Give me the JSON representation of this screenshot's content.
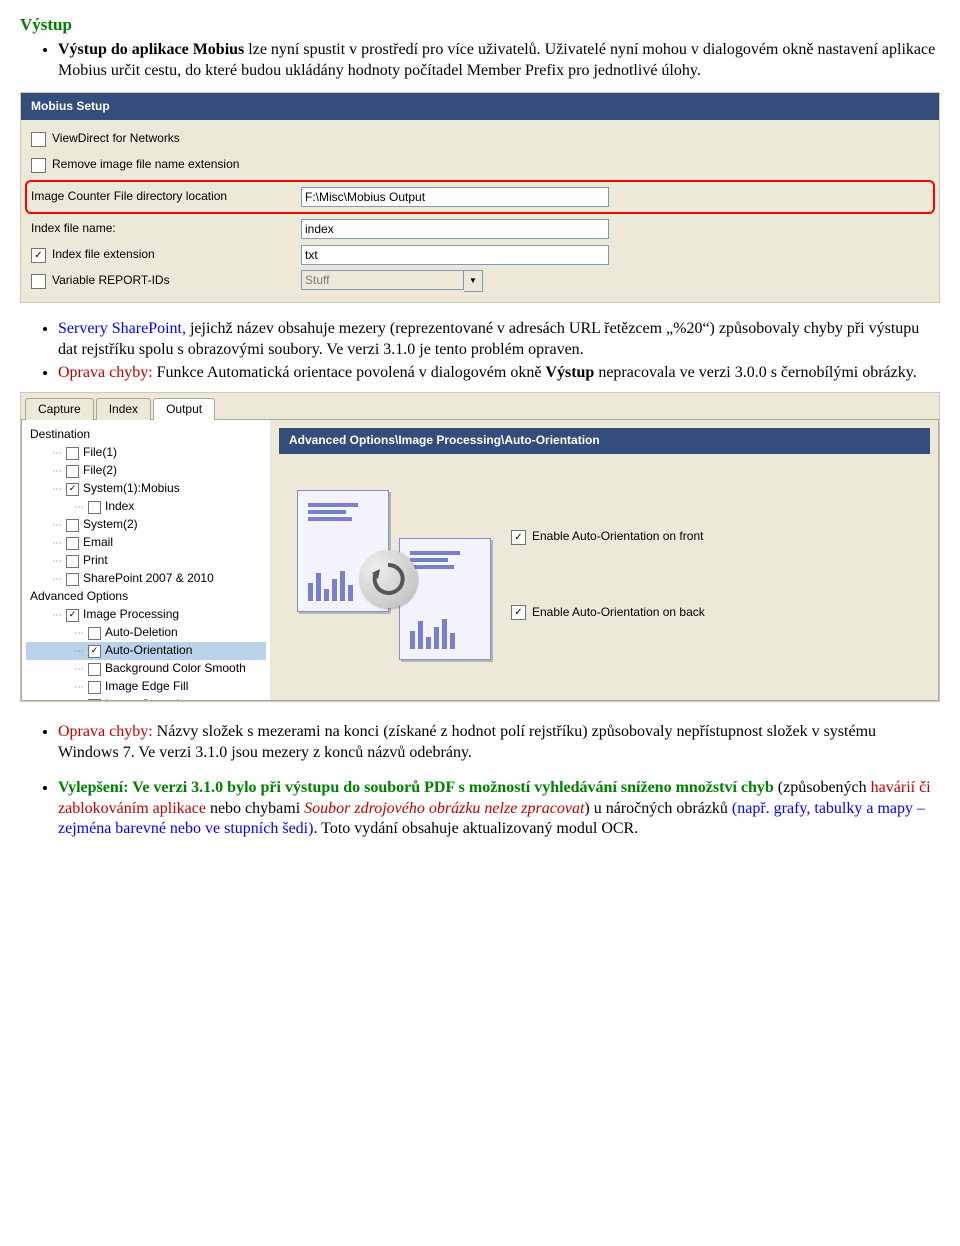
{
  "heading": "Výstup",
  "intro_bullet": {
    "before_bold": "",
    "bold": "Výstup do aplikace Mobius",
    "after": " lze nyní spustit v prostředí pro více uživatelů. Uživatelé nyní mohou v dialogovém okně nastavení aplikace Mobius určit cestu, do které budou ukládány hodnoty počítadel Member Prefix pro jednotlivé úlohy."
  },
  "mobius_panel": {
    "title": "Mobius Setup",
    "rows": [
      {
        "type": "checkbox",
        "label": "ViewDirect for Networks",
        "checked": false
      },
      {
        "type": "checkbox",
        "label": "Remove image file name extension",
        "checked": false
      },
      {
        "type": "labelinput",
        "label": "Image Counter File directory location",
        "value": "F:\\Misc\\Mobius Output",
        "highlight": true
      },
      {
        "type": "labelinput",
        "label": "Index file name:",
        "value": "index"
      },
      {
        "type": "checkinput",
        "label": "Index file extension",
        "checked": true,
        "value": "txt"
      },
      {
        "type": "checkdropdown",
        "label": "Variable REPORT-IDs",
        "checked": false,
        "value": "Stuff",
        "disabled": true
      }
    ]
  },
  "mid_bullets": [
    {
      "prefix_blue": "Servery SharePoint,",
      "rest": " jejichž název obsahuje mezery (reprezentované v adresách URL řetězcem „%20“) způsobovaly chyby při výstupu dat rejstříku spolu s obrazovými soubory. Ve verzi 3.1.0 je tento problém opraven."
    },
    {
      "prefix_red": "Oprava chyby:",
      "rest1": " Funkce Automatická orientace povolená v dialogovém okně ",
      "bold": "Výstup",
      "rest2": " nepracovala ve verzi 3.0.0 s černobílými obrázky."
    }
  ],
  "output_panel": {
    "tabs": [
      "Capture",
      "Index",
      "Output"
    ],
    "active_tab": 2,
    "tree": [
      {
        "label": "Destination",
        "indent": 0,
        "hasbox": false
      },
      {
        "label": "File(1)",
        "indent": 1,
        "hasbox": true,
        "checked": false
      },
      {
        "label": "File(2)",
        "indent": 1,
        "hasbox": true,
        "checked": false
      },
      {
        "label": "System(1):Mobius",
        "indent": 1,
        "hasbox": true,
        "checked": true
      },
      {
        "label": "Index",
        "indent": 2,
        "hasbox": true,
        "checked": false,
        "dotline": true
      },
      {
        "label": "System(2)",
        "indent": 1,
        "hasbox": true,
        "checked": false
      },
      {
        "label": "Email",
        "indent": 1,
        "hasbox": true,
        "checked": false
      },
      {
        "label": "Print",
        "indent": 1,
        "hasbox": true,
        "checked": false
      },
      {
        "label": "SharePoint 2007 & 2010",
        "indent": 1,
        "hasbox": true,
        "checked": false
      },
      {
        "label": "Advanced Options",
        "indent": 0,
        "hasbox": false
      },
      {
        "label": "Image Processing",
        "indent": 1,
        "hasbox": true,
        "checked": true
      },
      {
        "label": "Auto-Deletion",
        "indent": 2,
        "hasbox": true,
        "checked": false
      },
      {
        "label": "Auto-Orientation",
        "indent": 2,
        "hasbox": true,
        "checked": true,
        "selected": true
      },
      {
        "label": "Background Color Smooth",
        "indent": 2,
        "hasbox": true,
        "checked": false
      },
      {
        "label": "Image Edge Fill",
        "indent": 2,
        "hasbox": true,
        "checked": false
      },
      {
        "label": "Image Stamping",
        "indent": 2,
        "hasbox": true,
        "checked": false
      }
    ],
    "right_title": "Advanced Options\\Image Processing\\Auto-Orientation",
    "check_front": "Enable Auto-Orientation on front",
    "check_back": "Enable Auto-Orientation on back"
  },
  "lower_bullets": [
    {
      "prefix_red": "Oprava chyby:",
      "rest": " Názvy složek s mezerami na konci (získané z hodnot polí rejstříku) způsobovaly nepřístupnost složek v systému Windows 7. Ve verzi 3.1.0 jsou mezery z konců názvů odebrány."
    }
  ],
  "final_bullet": {
    "green_bold": "Vylepšení: Ve verzi 3.1.0 bylo při výstupu do souborů PDF s možností vyhledávání sníženo množství chyb",
    "black1": " (způsobených ",
    "red1": "havárií či zablokováním aplikace",
    "black2": " nebo chybami ",
    "red_italic": "Soubor zdrojového obrázku nelze zpracovat",
    "black3": ") u náročných obrázků ",
    "blue1": "(např. grafy, tabulky a mapy – zejména barevné nebo ve stupních šedi)",
    "black4": ". Toto vydání obsahuje aktualizovaný modul OCR."
  }
}
